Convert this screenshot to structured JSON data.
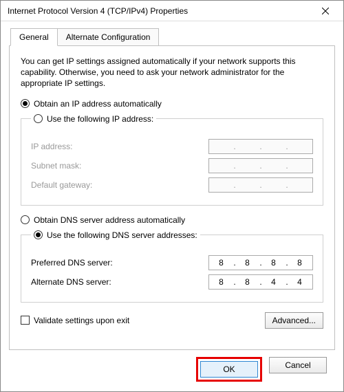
{
  "window": {
    "title": "Internet Protocol Version 4 (TCP/IPv4) Properties"
  },
  "tabs": {
    "general": "General",
    "alt": "Alternate Configuration"
  },
  "intro": "You can get IP settings assigned automatically if your network supports this capability. Otherwise, you need to ask your network administrator for the appropriate IP settings.",
  "ip": {
    "auto": "Obtain an IP address automatically",
    "manual": "Use the following IP address:",
    "addr_label": "IP address:",
    "mask_label": "Subnet mask:",
    "gw_label": "Default gateway:",
    "addr": [
      "",
      "",
      "",
      ""
    ],
    "mask": [
      "",
      "",
      "",
      ""
    ],
    "gw": [
      "",
      "",
      "",
      ""
    ]
  },
  "dns": {
    "auto": "Obtain DNS server address automatically",
    "manual": "Use the following DNS server addresses:",
    "pref_label": "Preferred DNS server:",
    "alt_label": "Alternate DNS server:",
    "pref": [
      "8",
      "8",
      "8",
      "8"
    ],
    "alt": [
      "8",
      "8",
      "4",
      "4"
    ]
  },
  "validate": "Validate settings upon exit",
  "buttons": {
    "advanced": "Advanced...",
    "ok": "OK",
    "cancel": "Cancel"
  },
  "dot": "."
}
